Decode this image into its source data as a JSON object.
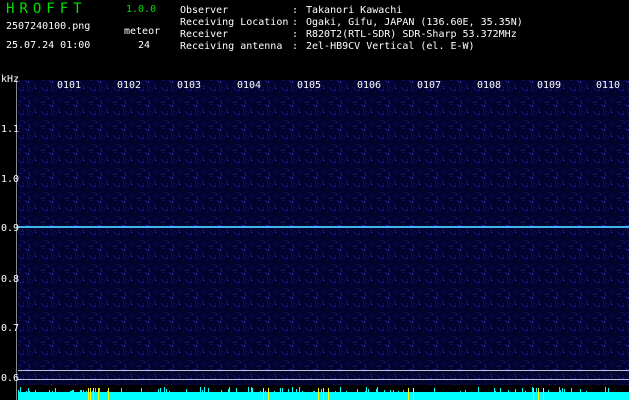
{
  "app": {
    "title": "HROFFT",
    "version": "1.0.0"
  },
  "file": {
    "name": "2507240100.png",
    "datetime": "25.07.24 01:00"
  },
  "meteor": {
    "label": "meteor",
    "count": "24"
  },
  "info": [
    {
      "label": "Observer",
      "sep": ":",
      "value": "Takanori Kawachi"
    },
    {
      "label": "Receiving Location",
      "sep": ":",
      "value": "Ogaki, Gifu, JAPAN (136.60E, 35.35N)"
    },
    {
      "label": "Receiver",
      "sep": ":",
      "value": "R820T2(RTL-SDR) SDR-Sharp 53.372MHz"
    },
    {
      "label": "Receiving antenna",
      "sep": ":",
      "value": "2el-HB9CV Vertical (el. E-W)"
    }
  ],
  "axis": {
    "unit": "kHz",
    "y_ticks": [
      "1.1",
      "1.0",
      "0.9",
      "0.8",
      "0.7",
      "0.6"
    ],
    "x_ticks": [
      "0101",
      "0102",
      "0103",
      "0104",
      "0105",
      "0106",
      "0107",
      "0108",
      "0109",
      "0110"
    ]
  },
  "colors": {
    "background": "#000000",
    "noise": "#0a0a6e",
    "carrier": "#40c8ff",
    "title": "#00e000",
    "baseline": "#00ffff",
    "marker": "#ffff00"
  }
}
